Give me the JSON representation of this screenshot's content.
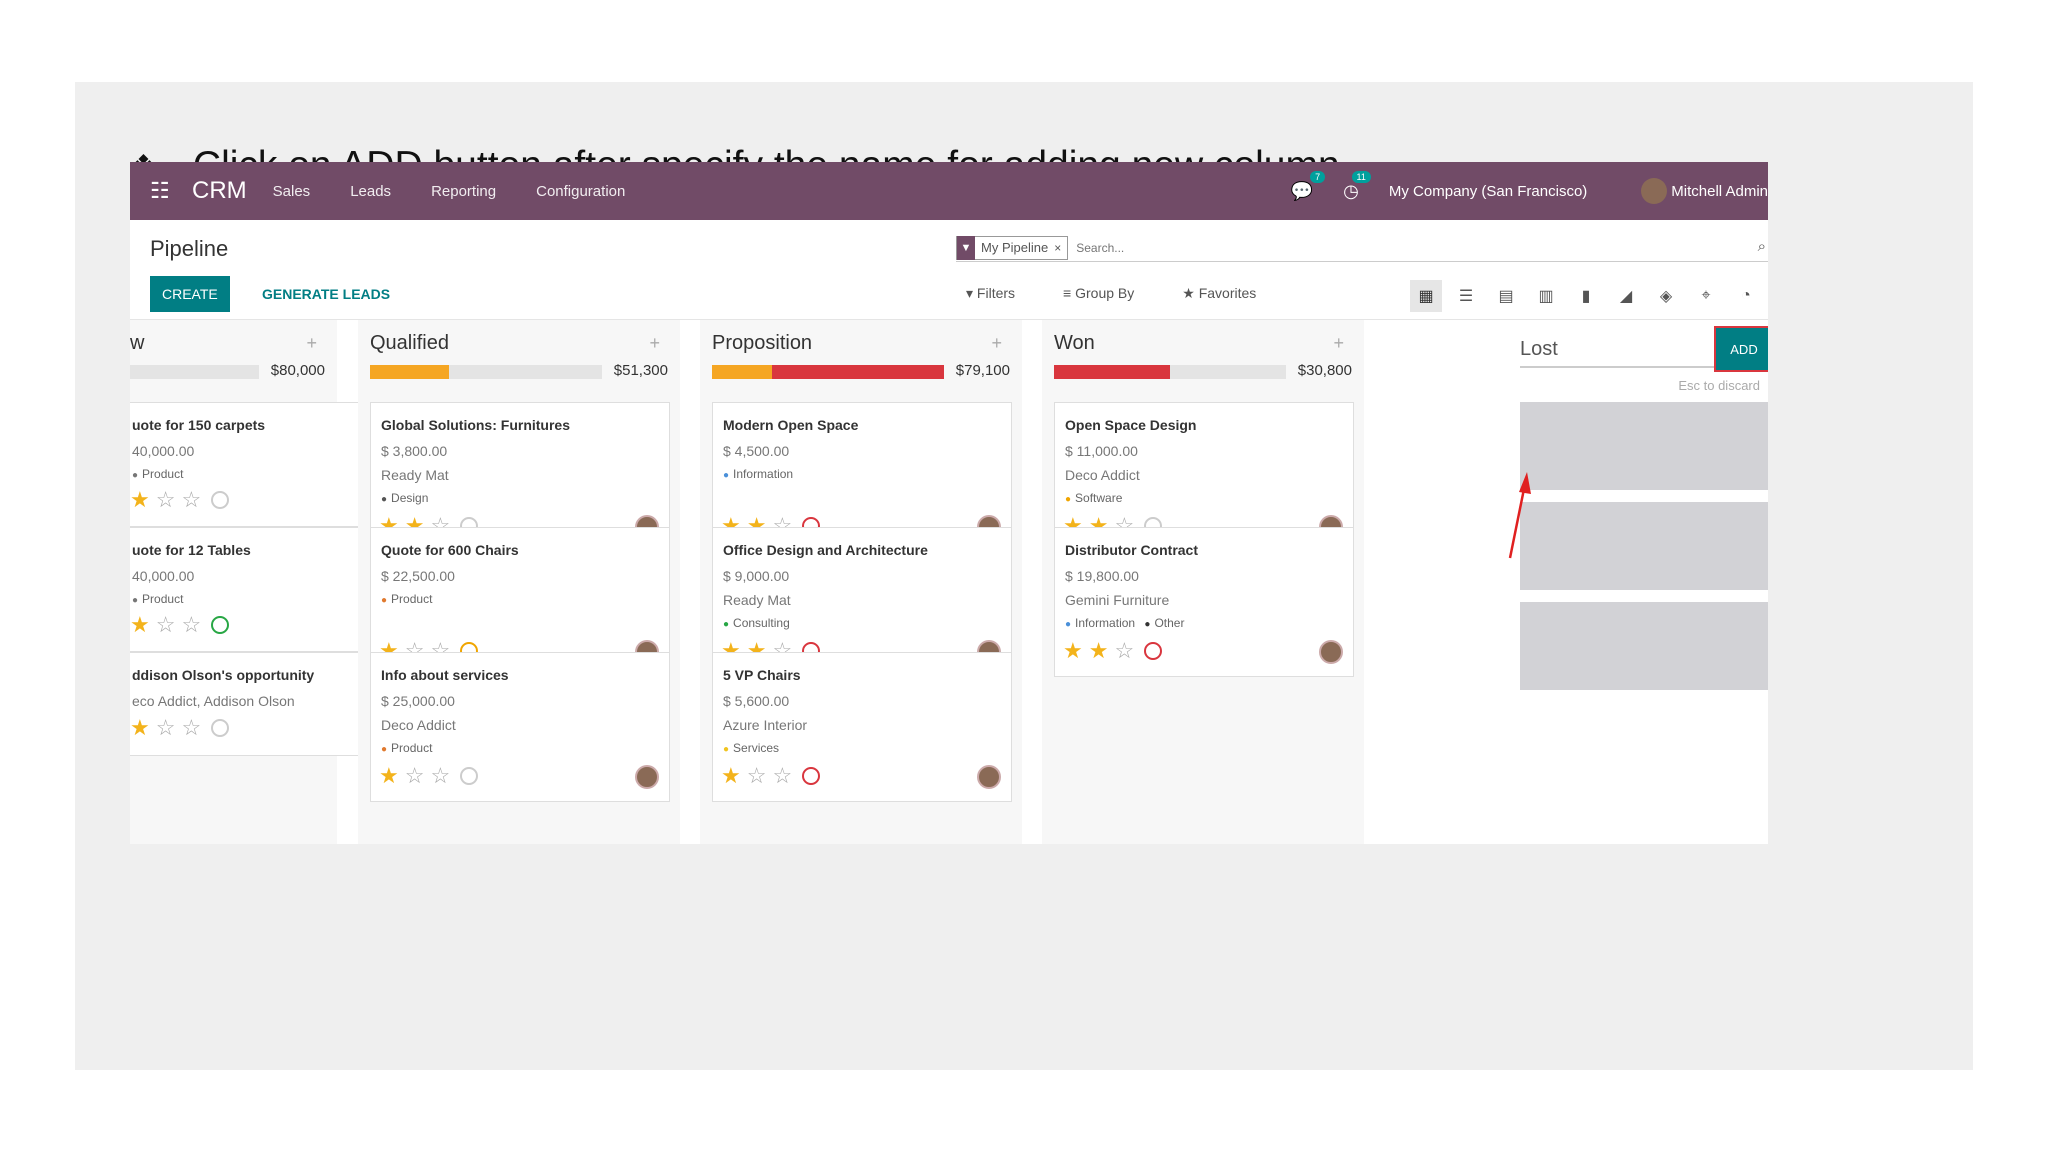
{
  "instruction": {
    "bullet": "❖",
    "text": "Click on ADD button after specify the name for adding new column."
  },
  "nav": {
    "apps_icon": "grid-icon",
    "brand": "CRM",
    "menu": [
      "Sales",
      "Leads",
      "Reporting",
      "Configuration"
    ],
    "chat_badge": "7",
    "activity_badge": "11",
    "company": "My Company (San Francisco)",
    "user": "Mitchell Admin"
  },
  "control": {
    "title": "Pipeline",
    "create": "CREATE",
    "generate_leads": "GENERATE LEADS",
    "facet": "My Pipeline",
    "facet_remove": "×",
    "search_placeholder": "Search...",
    "filters": "Filters",
    "group_by": "Group By",
    "favorites": "Favorites"
  },
  "columns": [
    {
      "name": "w",
      "total": "$80,000",
      "progress": {
        "green": 0.27,
        "orange": 0,
        "red": 0
      },
      "cards": [
        {
          "title": "uote for 150 carpets",
          "amount": "40,000.00",
          "company": "",
          "tag": "Product",
          "tag_color": "#777",
          "stars": 1,
          "activity": "grey"
        },
        {
          "title": "uote for 12 Tables",
          "amount": "40,000.00",
          "company": "",
          "tag": "Product",
          "tag_color": "#777",
          "stars": 1,
          "activity": "green"
        },
        {
          "title": "ddison Olson's opportunity",
          "amount": "",
          "company": "eco Addict, Addison Olson",
          "tag": "",
          "tag_color": "#777",
          "stars": 1,
          "activity": "grey"
        }
      ]
    },
    {
      "name": "Qualified",
      "total": "$51,300",
      "progress": {
        "green": 0,
        "orange": 0.34,
        "red": 0
      },
      "cards": [
        {
          "title": "Global Solutions: Furnitures",
          "amount": "$ 3,800.00",
          "company": "Ready Mat",
          "tag": "Design",
          "tag_color": "#555",
          "stars": 2,
          "activity": "grey"
        },
        {
          "title": "Quote for 600 Chairs",
          "amount": "$ 22,500.00",
          "company": "",
          "tag": "Product",
          "tag_color": "#e07a2f",
          "stars": 1,
          "activity": "orange"
        },
        {
          "title": "Info about services",
          "amount": "$ 25,000.00",
          "company": "Deco Addict",
          "tag": "Product",
          "tag_color": "#e07a2f",
          "stars": 1,
          "activity": "grey"
        }
      ]
    },
    {
      "name": "Proposition",
      "total": "$79,100",
      "progress": {
        "green": 0,
        "orange": 0.26,
        "red": 0.74
      },
      "cards": [
        {
          "title": "Modern Open Space",
          "amount": "$ 4,500.00",
          "company": "",
          "tag": "Information",
          "tag_color": "#4a90d9",
          "stars": 2,
          "activity": "red"
        },
        {
          "title": "Office Design and Architecture",
          "amount": "$ 9,000.00",
          "company": "Ready Mat",
          "tag": "Consulting",
          "tag_color": "#28a745",
          "stars": 2,
          "activity": "red"
        },
        {
          "title": "5 VP Chairs",
          "amount": "$ 5,600.00",
          "company": "Azure Interior",
          "tag": "Services",
          "tag_color": "#f0c420",
          "stars": 1,
          "activity": "red"
        }
      ]
    },
    {
      "name": "Won",
      "total": "$30,800",
      "progress": {
        "green": 0,
        "orange": 0,
        "red": 0.5
      },
      "cards": [
        {
          "title": "Open Space Design",
          "amount": "$ 11,000.00",
          "company": "Deco Addict",
          "tag": "Software",
          "tag_color": "#f0a500",
          "stars": 2,
          "activity": "grey"
        },
        {
          "title": "Distributor Contract",
          "amount": "$ 19,800.00",
          "company": "Gemini Furniture",
          "tag": "Information",
          "tag2": "Other",
          "tag_color": "#4a90d9",
          "stars": 2,
          "activity": "red"
        }
      ]
    }
  ],
  "new_column": {
    "value": "Lost",
    "add": "ADD",
    "hint": "Esc to discard"
  },
  "colors": {
    "nav": "#714b67",
    "primary": "#017e84",
    "green": "#21b24b",
    "orange": "#f5a623",
    "red": "#d9363e"
  }
}
